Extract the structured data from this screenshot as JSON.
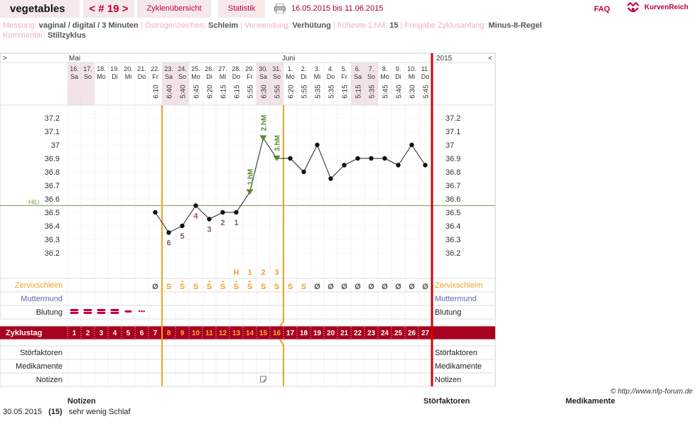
{
  "header": {
    "app_title": "vegetables",
    "cycle_nav": "< # 19 >",
    "tab_overview": "Zyklenübersicht",
    "tab_stats": "Statistik",
    "date_range": "16.05.2015 bis 11.06.2015",
    "faq": "FAQ",
    "logo_text": "KurvenReich"
  },
  "meta": {
    "messung_label": "Messung:",
    "messung_value": "vaginal / digital / 3 Minuten",
    "oestrogen_label": "Östrogenzeichen:",
    "oestrogen_value": "Schleim",
    "verwendung_label": "Verwendung:",
    "verwendung_value": "Verhütung",
    "hm_label": "früheste 1.hM:",
    "hm_value": "15",
    "freigabe_label": "Freigabe Zyklusanfang:",
    "freigabe_value": "Minus-8-Regel",
    "kommentar_label": "Kommentar:",
    "kommentar_value": "Stillzyklus"
  },
  "chart": {
    "nav_left": ">",
    "nav_right": "<",
    "month1": "Mai",
    "month2": "Juni",
    "year": "2015",
    "days": [
      {
        "d": "16.",
        "w": "Sa",
        "t": "",
        "we": true
      },
      {
        "d": "17.",
        "w": "So",
        "t": "",
        "we": true
      },
      {
        "d": "18.",
        "w": "Mo",
        "t": ""
      },
      {
        "d": "19.",
        "w": "Di",
        "t": ""
      },
      {
        "d": "20.",
        "w": "Mi",
        "t": ""
      },
      {
        "d": "21.",
        "w": "Do",
        "t": ""
      },
      {
        "d": "22.",
        "w": "Fr",
        "t": "6:10"
      },
      {
        "d": "23.",
        "w": "Sa",
        "t": "6:40",
        "we": true
      },
      {
        "d": "24.",
        "w": "So",
        "t": "5:40",
        "we": true
      },
      {
        "d": "25.",
        "w": "Mo",
        "t": "6:45"
      },
      {
        "d": "26.",
        "w": "Di",
        "t": "6:20"
      },
      {
        "d": "27.",
        "w": "Mi",
        "t": "6:15"
      },
      {
        "d": "28.",
        "w": "Do",
        "t": "6:15"
      },
      {
        "d": "29.",
        "w": "Fr",
        "t": "5:55"
      },
      {
        "d": "30.",
        "w": "Sa",
        "t": "6:30",
        "we": true
      },
      {
        "d": "31.",
        "w": "So",
        "t": "5:55",
        "we": true
      },
      {
        "d": "1.",
        "w": "Mo",
        "t": "6:20"
      },
      {
        "d": "2.",
        "w": "Di",
        "t": "5:55"
      },
      {
        "d": "3.",
        "w": "Mi",
        "t": "5:35"
      },
      {
        "d": "4.",
        "w": "Do",
        "t": "5:35"
      },
      {
        "d": "5.",
        "w": "Fr",
        "t": "6:15"
      },
      {
        "d": "6.",
        "w": "Sa",
        "t": "5:15",
        "we": true
      },
      {
        "d": "7.",
        "w": "So",
        "t": "5:35",
        "we": true
      },
      {
        "d": "8.",
        "w": "Mo",
        "t": "5:45"
      },
      {
        "d": "9.",
        "w": "Di",
        "t": "5:40"
      },
      {
        "d": "10.",
        "w": "Mi",
        "t": "6:30"
      },
      {
        "d": "11.",
        "w": "Do",
        "t": "5:45"
      }
    ],
    "y_ticks": [
      "37.2",
      "37.1",
      "37",
      "36.9",
      "36.8",
      "36.7",
      "36.6",
      "36.5",
      "36.4",
      "36.3",
      "36.2"
    ],
    "hili_label": "HiLi",
    "hili_value": 36.55,
    "temps": [
      null,
      null,
      null,
      null,
      null,
      null,
      36.5,
      36.35,
      36.4,
      36.55,
      36.45,
      36.5,
      36.5,
      36.65,
      37.05,
      36.9,
      36.9,
      36.8,
      37.0,
      36.75,
      36.85,
      36.9,
      36.9,
      36.9,
      36.85,
      37.0,
      36.85
    ],
    "low_labels": [
      {
        "day": 8,
        "text": "6"
      },
      {
        "day": 9,
        "text": "5"
      },
      {
        "day": 10,
        "text": "4"
      },
      {
        "day": 11,
        "text": "3"
      },
      {
        "day": 12,
        "text": "2"
      },
      {
        "day": 13,
        "text": "1"
      }
    ],
    "high_labels": [
      {
        "day": 14,
        "text": "1.hM"
      },
      {
        "day": 15,
        "text": "2.hM"
      },
      {
        "day": 16,
        "text": "3.hM"
      }
    ],
    "peak_row": [
      {
        "day": 13,
        "text": "H"
      },
      {
        "day": 14,
        "text": "1"
      },
      {
        "day": 15,
        "text": "2"
      },
      {
        "day": 16,
        "text": "3"
      }
    ],
    "rows": {
      "zervix": "Zervixschleim",
      "muttermund": "Muttermund",
      "blutung": "Blutung",
      "zyklustag": "Zyklustag",
      "stoer": "Störfaktoren",
      "medi": "Medikamente",
      "notizen": "Notizen"
    },
    "zervix_values": [
      "",
      "",
      "",
      "",
      "",
      "",
      "Ø",
      "S",
      "S",
      "S",
      "S",
      "S",
      "S",
      "S",
      "S",
      "S",
      "S",
      "S",
      "Ø",
      "Ø",
      "Ø",
      "Ø",
      "Ø",
      "Ø",
      "Ø",
      "Ø",
      "Ø"
    ],
    "zervix_plus": [
      false,
      false,
      false,
      false,
      false,
      false,
      false,
      false,
      true,
      false,
      true,
      true,
      true,
      true,
      false,
      false,
      false,
      false,
      false,
      false,
      false,
      false,
      false,
      false,
      false,
      false,
      false
    ],
    "blutung": [
      3,
      3,
      2,
      2,
      1,
      0.5,
      0,
      0,
      0,
      0,
      0,
      0,
      0,
      0,
      0,
      0,
      0,
      0,
      0,
      0,
      0,
      0,
      0,
      0,
      0,
      0,
      0
    ],
    "cycle_days": [
      "1",
      "2",
      "3",
      "4",
      "5",
      "6",
      "7",
      "8",
      "9",
      "10",
      "11",
      "12",
      "13",
      "14",
      "15",
      "16",
      "17",
      "18",
      "19",
      "20",
      "21",
      "22",
      "23",
      "24",
      "25",
      "26",
      "27"
    ],
    "note_day": 15,
    "colors": {
      "accent": "#c0003a",
      "orange": "#f0a020",
      "green": "#5a8a2a",
      "low_label": "#8a5a6a",
      "blue": "#5a6ab0",
      "zyklustag_bg": "#a8001e"
    }
  },
  "footer": {
    "copyright": "© http://www.nfp-forum.de",
    "notes_col": "Notizen",
    "stoer_col": "Störfaktoren",
    "medi_col": "Medikamente",
    "note_date": "30.05.2015",
    "note_day": "(15)",
    "note_text": "sehr wenig Schlaf"
  }
}
